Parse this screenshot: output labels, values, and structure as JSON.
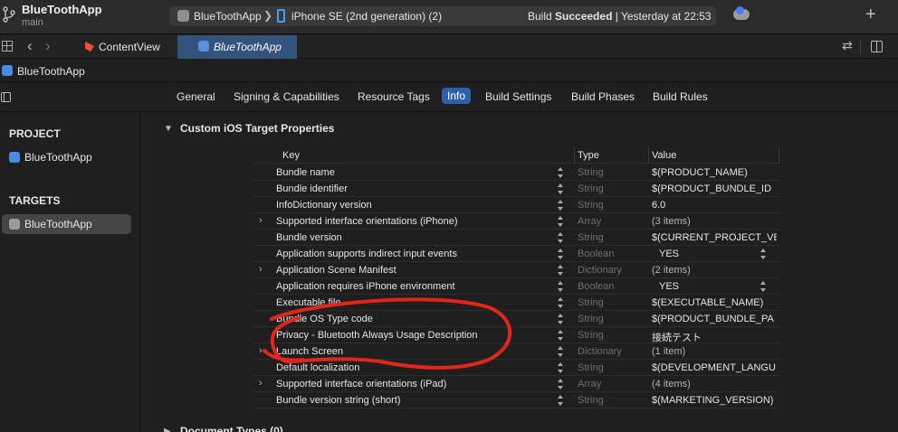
{
  "window": {
    "app_title": "BlueToothApp",
    "branch": "main"
  },
  "scheme": {
    "app": "BlueToothApp",
    "device": "iPhone SE (2nd generation) (2)",
    "status_prefix": "Build ",
    "status_bold": "Succeeded",
    "status_suffix": " | Yesterday at 22:53"
  },
  "tabs": [
    {
      "label": "ContentView"
    },
    {
      "label": "BlueToothApp"
    }
  ],
  "jumpbar": {
    "title": "BlueToothApp"
  },
  "settings_tabs": [
    "General",
    "Signing & Capabilities",
    "Resource Tags",
    "Info",
    "Build Settings",
    "Build Phases",
    "Build Rules"
  ],
  "active_settings_tab": "Info",
  "sidebar": {
    "project_header": "PROJECT",
    "project_item": "BlueToothApp",
    "targets_header": "TARGETS",
    "target_item": "BlueToothApp"
  },
  "main": {
    "section_title": "Custom iOS Target Properties",
    "next_section_title": "Document Types (0)",
    "columns": {
      "key": "Key",
      "type": "Type",
      "value": "Value"
    },
    "rows": [
      {
        "key": "Bundle name",
        "type": "String",
        "value": "$(PRODUCT_NAME)",
        "expandable": false
      },
      {
        "key": "Bundle identifier",
        "type": "String",
        "value": "$(PRODUCT_BUNDLE_ID",
        "expandable": false
      },
      {
        "key": "InfoDictionary version",
        "type": "String",
        "value": "6.0",
        "expandable": false
      },
      {
        "key": "Supported interface orientations (iPhone)",
        "type": "Array",
        "value": "(3 items)",
        "expandable": true
      },
      {
        "key": "Bundle version",
        "type": "String",
        "value": "$(CURRENT_PROJECT_VE",
        "expandable": false
      },
      {
        "key": "Application supports indirect input events",
        "type": "Boolean",
        "value": "YES",
        "expandable": false
      },
      {
        "key": "Application Scene Manifest",
        "type": "Dictionary",
        "value": "(2 items)",
        "expandable": true
      },
      {
        "key": "Application requires iPhone environment",
        "type": "Boolean",
        "value": "YES",
        "expandable": false
      },
      {
        "key": "Executable file",
        "type": "String",
        "value": "$(EXECUTABLE_NAME)",
        "expandable": false
      },
      {
        "key": "Bundle OS Type code",
        "type": "String",
        "value": "$(PRODUCT_BUNDLE_PA",
        "expandable": false
      },
      {
        "key": "Privacy - Bluetooth Always Usage Description",
        "type": "String",
        "value": "接続テスト",
        "expandable": false
      },
      {
        "key": "Launch Screen",
        "type": "Dictionary",
        "value": "(1 item)",
        "expandable": true
      },
      {
        "key": "Default localization",
        "type": "String",
        "value": "$(DEVELOPMENT_LANGU",
        "expandable": false
      },
      {
        "key": "Supported interface orientations (iPad)",
        "type": "Array",
        "value": "(4 items)",
        "expandable": true
      },
      {
        "key": "Bundle version string (short)",
        "type": "String",
        "value": "$(MARKETING_VERSION)",
        "expandable": false
      }
    ]
  },
  "colors": {
    "accent": "#2f5fa8",
    "annotation": "#e3261c"
  }
}
